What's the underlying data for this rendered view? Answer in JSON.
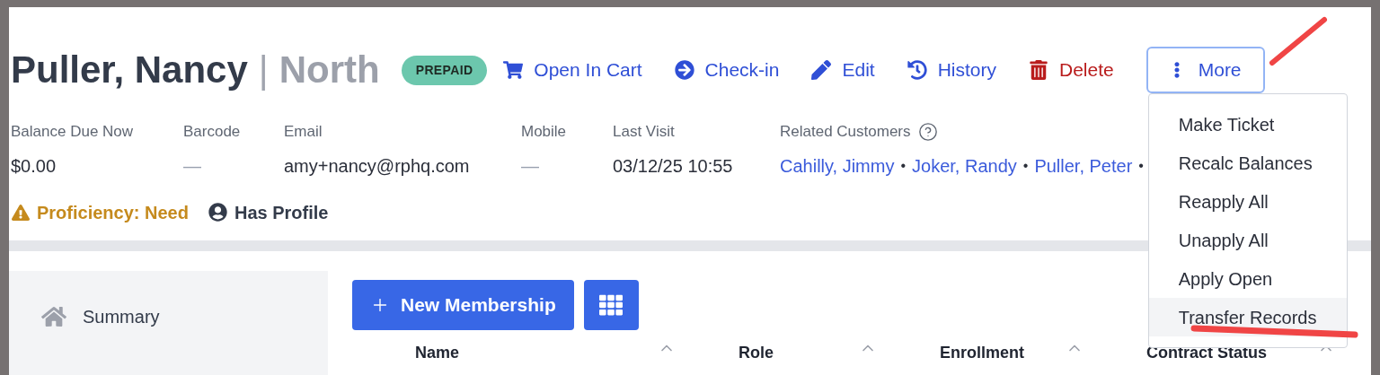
{
  "header": {
    "name": "Puller, Nancy",
    "separator": "|",
    "location": "North",
    "badge": "PREPAID",
    "actions": [
      {
        "kind": "cart",
        "label": "Open In Cart"
      },
      {
        "kind": "checkin",
        "label": "Check-in"
      },
      {
        "kind": "edit",
        "label": "Edit"
      },
      {
        "kind": "history",
        "label": "History"
      },
      {
        "kind": "delete",
        "label": "Delete"
      },
      {
        "kind": "more",
        "label": "More",
        "expanded": true
      }
    ]
  },
  "fields": [
    {
      "label": "Balance Due Now",
      "value": "$0.00"
    },
    {
      "label": "Barcode",
      "value": "—"
    },
    {
      "label": "Email",
      "value": "amy+nancy@rphq.com"
    },
    {
      "label": "Mobile",
      "value": "—"
    },
    {
      "label": "Last Visit",
      "value": "03/12/25 10:55"
    }
  ],
  "related_customers": {
    "label": "Related Customers",
    "separator": "•",
    "links": [
      "Cahilly, Jimmy",
      "Joker, Randy",
      "Puller, Peter"
    ]
  },
  "flags": [
    {
      "kind": "warning",
      "label": "Proficiency: Need"
    },
    {
      "kind": "profile",
      "label": "Has Profile"
    }
  ],
  "sidebar": {
    "items": [
      {
        "label": "Summary"
      }
    ]
  },
  "toolbar": {
    "new_button": "New Membership"
  },
  "table": {
    "columns": [
      "Name",
      "Role",
      "Enrollment",
      "Contract Status"
    ]
  },
  "more_menu": {
    "items": [
      {
        "label": "Make Ticket",
        "selected": false
      },
      {
        "label": "Recalc Balances",
        "selected": false
      },
      {
        "label": "Reapply All",
        "selected": false
      },
      {
        "label": "Unapply All",
        "selected": false
      },
      {
        "label": "Apply Open",
        "selected": false
      },
      {
        "label": "Transfer Records",
        "selected": true
      }
    ]
  }
}
